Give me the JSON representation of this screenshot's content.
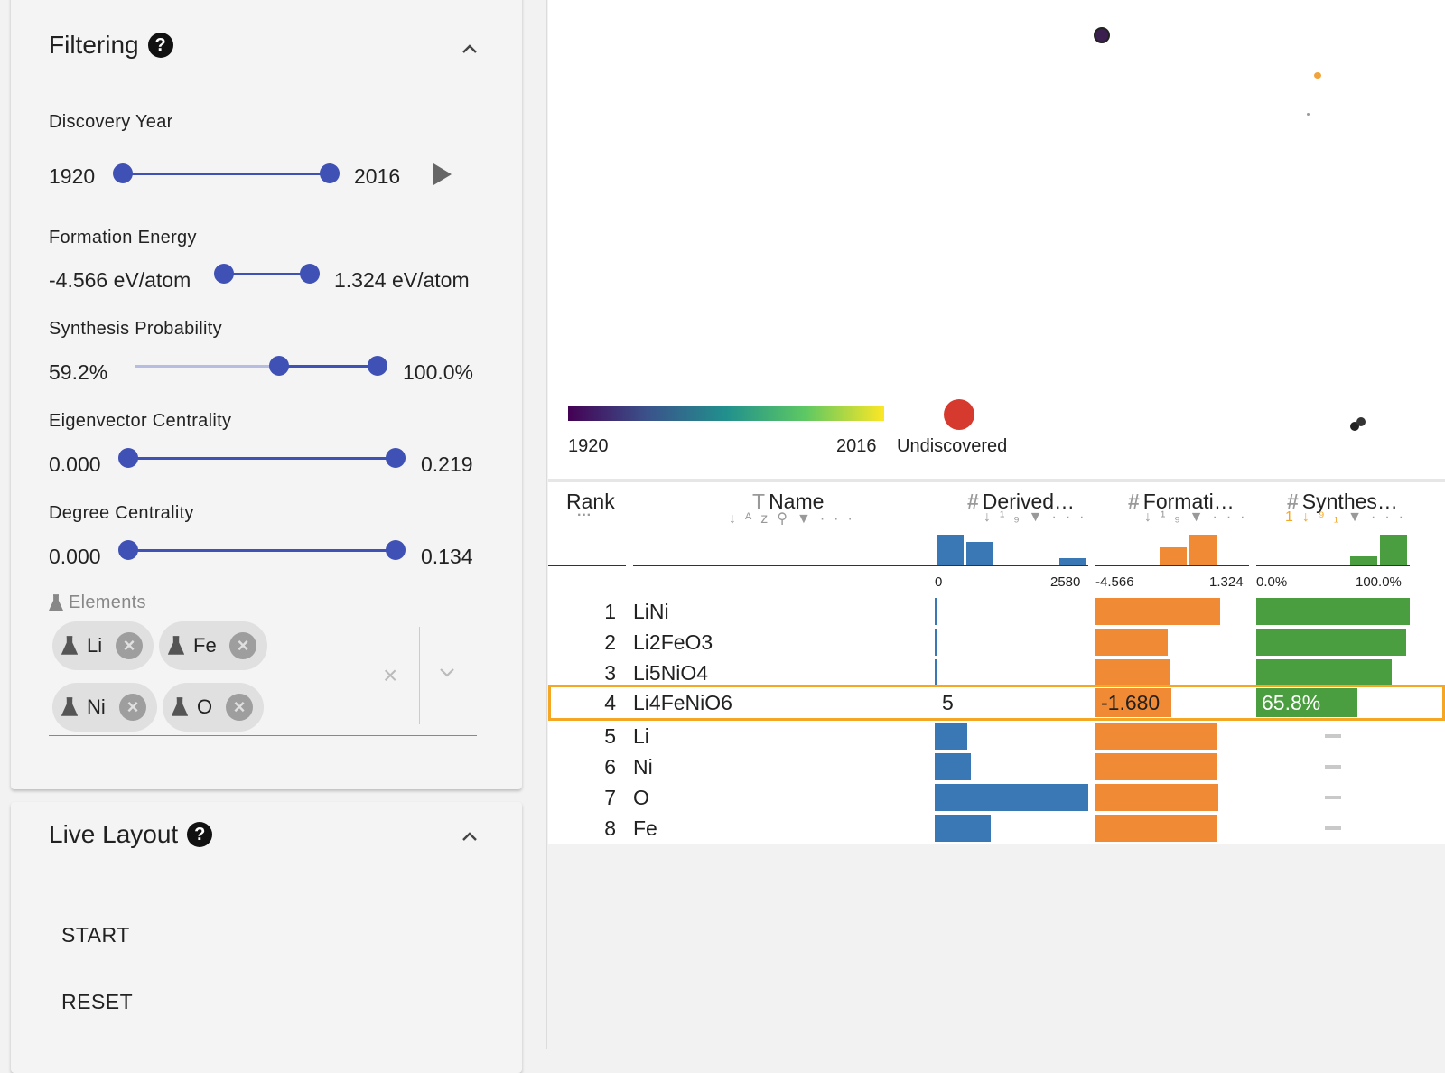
{
  "filtering": {
    "title": "Filtering",
    "discovery_year": {
      "label": "Discovery Year",
      "min": "1920",
      "max": "2016"
    },
    "formation_energy": {
      "label": "Formation Energy",
      "min": "-4.566 eV/atom",
      "max": "1.324 eV/atom"
    },
    "synthesis_probability": {
      "label": "Synthesis Probability",
      "min": "59.2%",
      "max": "100.0%"
    },
    "eigenvector_centrality": {
      "label": "Eigenvector Centrality",
      "min": "0.000",
      "max": "0.219"
    },
    "degree_centrality": {
      "label": "Degree Centrality",
      "min": "0.000",
      "max": "0.134"
    },
    "elements": {
      "label": "Elements",
      "chips": [
        "Li",
        "Fe",
        "Ni",
        "O"
      ]
    }
  },
  "live_layout": {
    "title": "Live Layout",
    "start": "START",
    "reset": "RESET"
  },
  "legend": {
    "min_year": "1920",
    "max_year": "2016",
    "undiscovered": "Undiscovered"
  },
  "colors": {
    "accent": "#3f51b5",
    "derived": "#3a78b5",
    "formation": "#f08a34",
    "synthesis": "#4a9e3f",
    "undiscovered": "#d63a2f",
    "selected": "#f5a623"
  },
  "table": {
    "headers": {
      "rank": "Rank",
      "name": "Name",
      "derived": "Derived…",
      "formation": "Formati…",
      "synthesis": "Synthes…"
    },
    "axes": {
      "derived_min": "0",
      "derived_max": "2580",
      "formation_min": "-4.566",
      "formation_max": "1.324",
      "synthesis_min": "0.0%",
      "synthesis_max": "100.0%"
    },
    "rows": [
      {
        "rank": "1",
        "name": "LiNi"
      },
      {
        "rank": "2",
        "name": "Li2FeO3"
      },
      {
        "rank": "3",
        "name": "Li5NiO4"
      },
      {
        "rank": "4",
        "name": "Li4FeNiO6",
        "derived": "5",
        "formation": "-1.680",
        "synthesis": "65.8%"
      },
      {
        "rank": "5",
        "name": "Li"
      },
      {
        "rank": "6",
        "name": "Ni"
      },
      {
        "rank": "7",
        "name": "O"
      },
      {
        "rank": "8",
        "name": "Fe"
      }
    ]
  }
}
